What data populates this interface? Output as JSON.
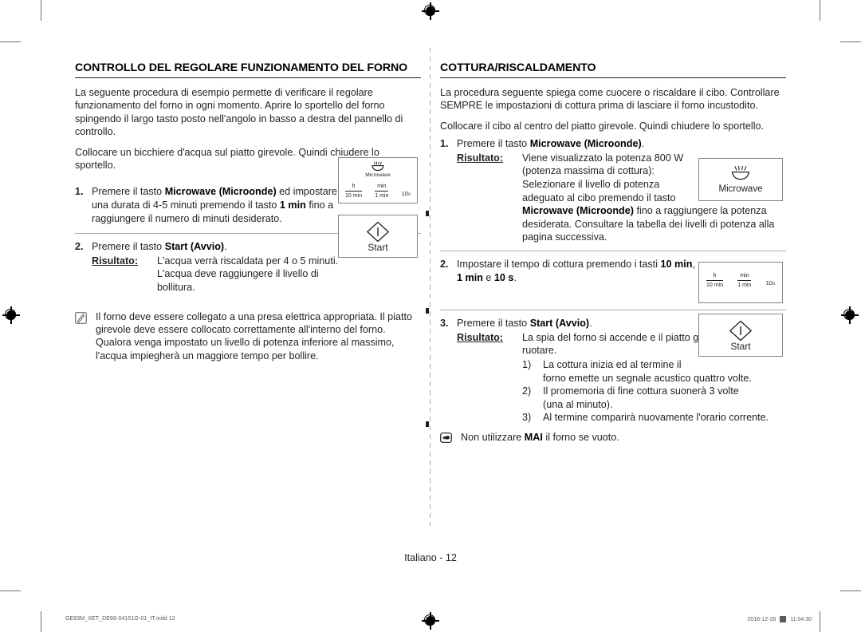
{
  "document": {
    "folio": "Italiano - 12",
    "footer_filename": "GE83M_XET_DE68-04151G-01_IT.indd   12",
    "footer_date": "2016-12-28",
    "footer_time": "11:04:30"
  },
  "left_column": {
    "title": "CONTROLLO DEL REGOLARE FUNZIONAMENTO DEL FORNO",
    "intro_1": "La seguente procedura di esempio permette di verificare il regolare funzionamento del forno in ogni momento. Aprire lo sportello del forno spingendo il largo tasto posto nell'angolo in basso a destra del pannello di controllo.",
    "intro_2": "Collocare un bicchiere d'acqua sul piatto girevole. Quindi chiudere lo sportello.",
    "step1": {
      "num": "1.",
      "text_a": "Premere il tasto ",
      "bold_a": "Microwave (Microonde)",
      "text_b": " ed impostare una durata di 4-5 minuti premendo il tasto ",
      "bold_b": "1 min",
      "text_c": " fino a raggiungere il numero di minuti desiderato."
    },
    "step2": {
      "num": "2.",
      "text_a": "Premere il tasto ",
      "bold_a": "Start (Avvio)",
      "text_b": ".",
      "result_label": "Risultato:",
      "result_text": "L'acqua verrà riscaldata per 4 o 5 minuti. L'acqua deve raggiungere il livello di bollitura."
    },
    "note": {
      "icon": "note-pencil-icon",
      "text": "Il forno deve essere collegato a una presa elettrica appropriata. Il piatto girevole deve essere collocato correttamente all'interno del forno. Qualora venga impostato un livello di potenza inferiore al massimo, l'acqua impiegherà un maggiore tempo per bollire."
    }
  },
  "right_column": {
    "title": "COTTURA/RISCALDAMENTO",
    "intro_1": "La procedura seguente spiega come cuocere o riscaldare il cibo. Controllare SEMPRE le impostazioni di cottura prima di lasciare il forno incustodito.",
    "intro_2": "Collocare il cibo al centro del piatto girevole. Quindi chiudere lo sportello.",
    "step1": {
      "num": "1.",
      "text_a": "Premere il tasto ",
      "bold_a": "Microwave (Microonde)",
      "text_b": ".",
      "result_label": "Risultato:",
      "result_line1": "Viene visualizzato la potenza 800 W",
      "result_line2": "(potenza massima di cottura):",
      "result_line3": "Selezionare il livello di potenza",
      "result_line4": "adeguato al cibo premendo il tasto",
      "result_bold": "Microwave (Microonde)",
      "result_line5": " fino a raggiungere la potenza desiderata. Consultare la tabella dei livelli di potenza alla pagina successiva."
    },
    "step2": {
      "num": "2.",
      "text_a": "Impostare il tempo di cottura premendo i tasti ",
      "bold_a": "10 min",
      "text_b": ", ",
      "bold_b": "1 min",
      "text_c": " e ",
      "bold_c": "10 s",
      "text_d": "."
    },
    "step3": {
      "num": "3.",
      "text_a": "Premere il tasto ",
      "bold_a": "Start (Avvio)",
      "text_b": ".",
      "result_label": "Risultato:",
      "result_text": "La spia del forno si accende e il piatto girevole inizia a ruotare.",
      "sub": [
        {
          "marker": "1)",
          "line1": "La cottura inizia ed al termine il",
          "line2": "forno emette un segnale acustico quattro volte."
        },
        {
          "marker": "2)",
          "line1": "Il promemoria di fine cottura suonerà 3 volte",
          "line2": "(una al minuto)."
        },
        {
          "marker": "3)",
          "line1": "Al termine comparirà nuovamente l'orario corrente.",
          "line2": ""
        }
      ]
    },
    "note": {
      "icon": "pointing-hand-icon",
      "text_a": "Non utilizzare ",
      "bold_a": "MAI",
      "text_b": " il forno se vuoto."
    }
  },
  "keyboxes": {
    "microwave_label": "Microwave",
    "timer": {
      "h_top": "h",
      "h_bot": "10 min",
      "min_top": "min",
      "min_bot": "1 min",
      "tens": "10",
      "tens_unit": "s"
    },
    "start_label": "Start"
  }
}
